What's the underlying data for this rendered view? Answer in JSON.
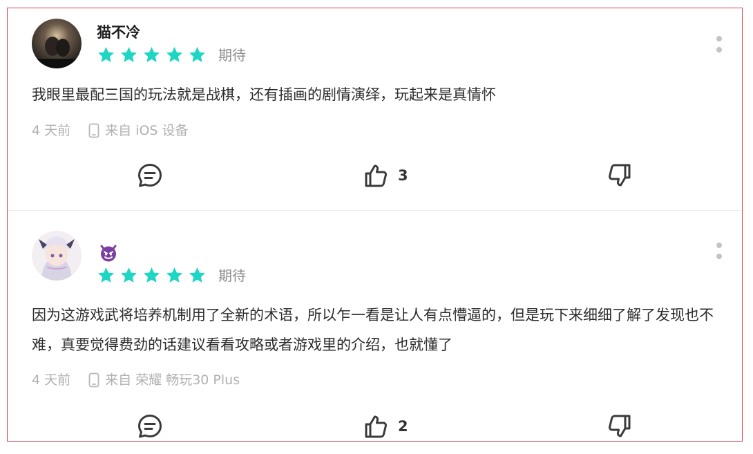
{
  "colors": {
    "star": "#1dd6c4",
    "border": "#d9434a",
    "muted": "#b0b0b0",
    "badge": "#7a3fa0"
  },
  "reviews": [
    {
      "username": "猫不冷",
      "rating": 5,
      "tag": "期待",
      "content": "我眼里最配三国的玩法就是战棋，还有插画的剧情演绎，玩起来是真情怀",
      "time": "4 天前",
      "device": "来自 iOS 设备",
      "likes": "3",
      "icons": {
        "avatar": "avatar-photo",
        "more": "more-vertical-icon",
        "device": "phone-icon",
        "comment": "comment-icon",
        "like": "thumbs-up-icon",
        "dislike": "thumbs-down-icon"
      }
    },
    {
      "username": "",
      "badge_icon": "devil-emoji-icon",
      "rating": 5,
      "tag": "期待",
      "content": "因为这游戏武将培养机制用了全新的术语，所以乍一看是让人有点懵逼的，但是玩下来细细了解了发现也不难，真要觉得费劲的话建议看看攻略或者游戏里的介绍，也就懂了",
      "time": "4 天前",
      "device": "来自 荣耀 畅玩30 Plus",
      "likes": "2",
      "icons": {
        "avatar": "anime-avatar",
        "more": "more-vertical-icon",
        "device": "phone-icon",
        "comment": "comment-icon",
        "like": "thumbs-up-icon",
        "dislike": "thumbs-down-icon"
      }
    }
  ]
}
